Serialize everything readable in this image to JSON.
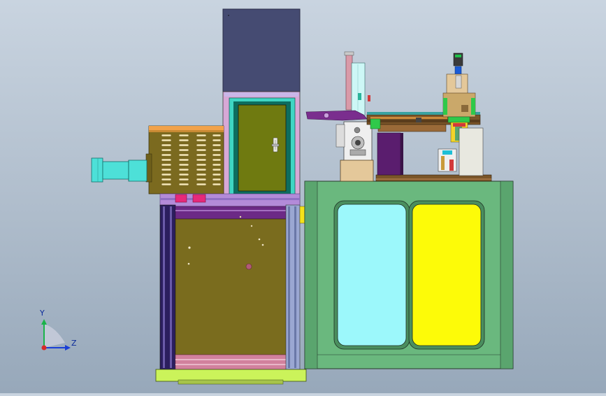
{
  "triad": {
    "y_label": "Y",
    "z_label": "Z"
  },
  "colors": {
    "cabinet_green": "#6ab87e",
    "window_cyan": "#9cf8fb",
    "window_yellow": "#fdfb08",
    "control_box_navy": "#454b72",
    "frame_olive": "#7a6c1e",
    "panel_olive": "#6f7a10",
    "teal_frame": "#4ad7c6",
    "base_lime": "#cbf35a",
    "mounting_purple": "#6c2a86",
    "nozzle_cyan": "#4de0d8"
  }
}
